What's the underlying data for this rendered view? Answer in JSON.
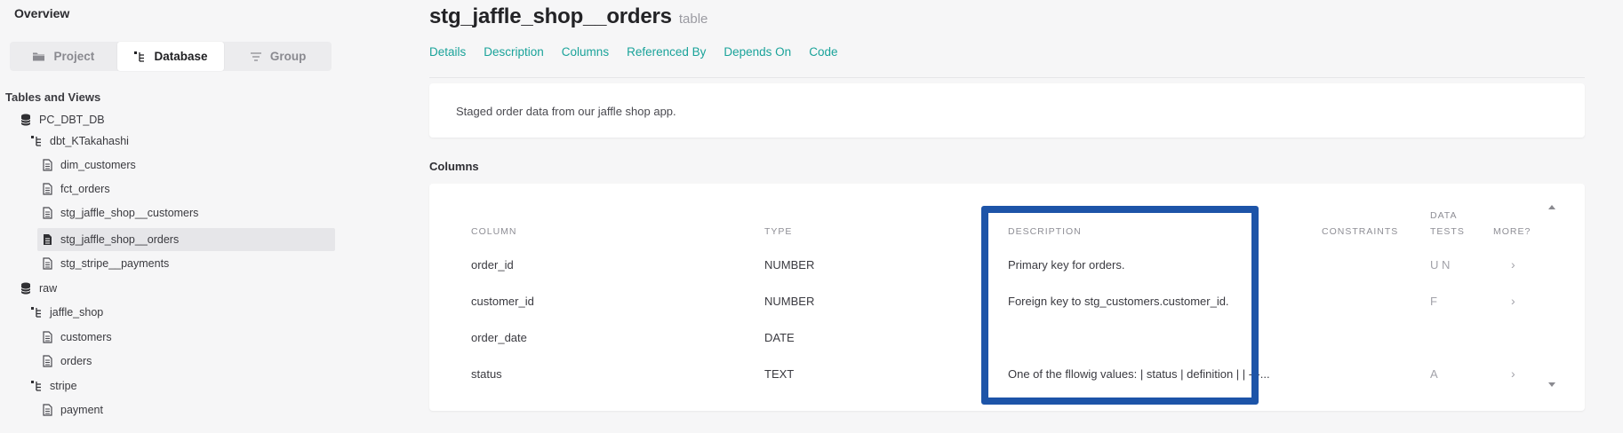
{
  "sidebar": {
    "overview": "Overview",
    "segments": [
      {
        "label": "Project",
        "icon": "folder-icon"
      },
      {
        "label": "Database",
        "icon": "tree-icon"
      },
      {
        "label": "Group",
        "icon": "filter-lines-icon"
      }
    ],
    "active_segment": "Database",
    "tables_title": "Tables and Views",
    "tree": [
      {
        "label": "PC_DBT_DB",
        "icon": "database-icon",
        "level": 0
      },
      {
        "label": "dbt_KTakahashi",
        "icon": "schema-icon",
        "level": 1
      },
      {
        "label": "dim_customers",
        "icon": "file-icon",
        "level": 2
      },
      {
        "label": "fct_orders",
        "icon": "file-icon",
        "level": 2
      },
      {
        "label": "stg_jaffle_shop__customers",
        "icon": "file-icon",
        "level": 2
      },
      {
        "label": "stg_jaffle_shop__orders",
        "icon": "file-icon",
        "level": 2,
        "selected": true
      },
      {
        "label": "stg_stripe__payments",
        "icon": "file-icon",
        "level": 2
      },
      {
        "label": "raw",
        "icon": "database-icon",
        "level": 0
      },
      {
        "label": "jaffle_shop",
        "icon": "schema-icon",
        "level": 1
      },
      {
        "label": "customers",
        "icon": "file-icon",
        "level": 2
      },
      {
        "label": "orders",
        "icon": "file-icon",
        "level": 2
      },
      {
        "label": "stripe",
        "icon": "schema-icon",
        "level": 1
      },
      {
        "label": "payment",
        "icon": "file-icon",
        "level": 2
      }
    ]
  },
  "main": {
    "title": "stg_jaffle_shop__orders",
    "title_type": "table",
    "tabs": [
      "Details",
      "Description",
      "Columns",
      "Referenced By",
      "Depends On",
      "Code"
    ],
    "description": "Staged order data from our jaffle shop app.",
    "columns_title": "Columns",
    "table": {
      "headers": {
        "column": "COLUMN",
        "type": "TYPE",
        "description": "DESCRIPTION",
        "constraints": "CONSTRAINTS",
        "data_tests_line1": "DATA",
        "data_tests_line2": "TESTS",
        "more": "MORE?"
      },
      "rows": [
        {
          "column": "order_id",
          "type": "NUMBER",
          "description": "Primary key for orders.",
          "tests": "U N",
          "more": "›"
        },
        {
          "column": "customer_id",
          "type": "NUMBER",
          "description": "Foreign key to stg_customers.customer_id.",
          "tests": "F",
          "more": "›"
        },
        {
          "column": "order_date",
          "type": "DATE",
          "description": "",
          "tests": "",
          "more": ""
        },
        {
          "column": "status",
          "type": "TEXT",
          "description": "One of the fllowig values: | status | definition | | ---...",
          "tests": "A",
          "more": "›"
        }
      ]
    }
  },
  "colors": {
    "accent": "#1aa39a",
    "highlight": "#1d54a8",
    "background": "#f6f6f7"
  }
}
